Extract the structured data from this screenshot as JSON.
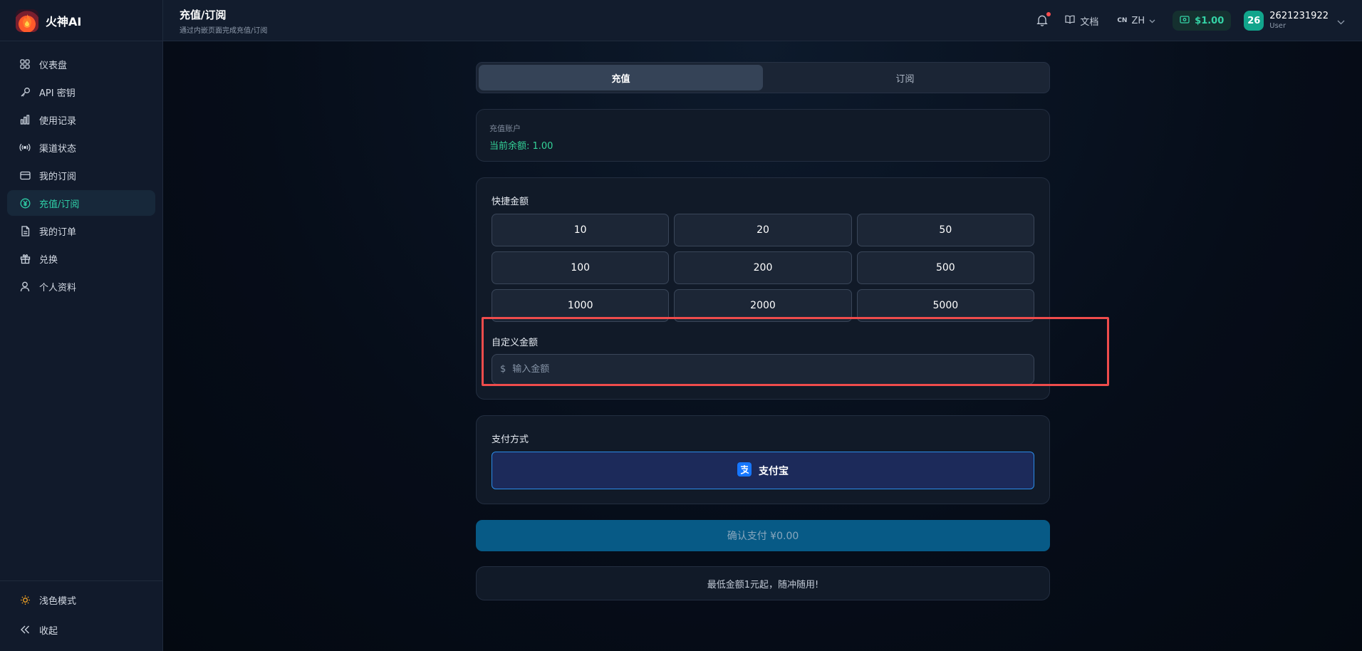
{
  "brand": {
    "name": "火神AI"
  },
  "sidebar": {
    "items": [
      {
        "label": "仪表盘",
        "icon": "grid-icon"
      },
      {
        "label": "API 密钥",
        "icon": "key-icon"
      },
      {
        "label": "使用记录",
        "icon": "bar-chart-icon"
      },
      {
        "label": "渠道状态",
        "icon": "broadcast-icon"
      },
      {
        "label": "我的订阅",
        "icon": "credit-card-icon"
      },
      {
        "label": "充值/订阅",
        "icon": "yuan-circle-icon",
        "active": true
      },
      {
        "label": "我的订单",
        "icon": "document-icon"
      },
      {
        "label": "兑换",
        "icon": "gift-icon"
      },
      {
        "label": "个人资料",
        "icon": "user-icon"
      }
    ],
    "bottom": [
      {
        "label": "浅色模式",
        "icon": "sun-icon"
      },
      {
        "label": "收起",
        "icon": "collapse-icon"
      }
    ]
  },
  "header": {
    "title": "充值/订阅",
    "subtitle": "通过内嵌页面完成充值/订阅",
    "docs_label": "文档",
    "lang_flag": "CN",
    "lang_label": "ZH",
    "balance": "$1.00",
    "avatar_text": "26",
    "user_name": "2621231922",
    "user_role": "User"
  },
  "tabs": [
    {
      "label": "充值",
      "active": true
    },
    {
      "label": "订阅",
      "active": false
    }
  ],
  "account": {
    "label": "充值账户",
    "balance_text": "当前余额: 1.00"
  },
  "quick_amounts": {
    "label": "快捷金额",
    "values": [
      "10",
      "20",
      "50",
      "100",
      "200",
      "500",
      "1000",
      "2000",
      "5000"
    ]
  },
  "custom_amount": {
    "label": "自定义金额",
    "currency": "$",
    "placeholder": "输入金额",
    "value": ""
  },
  "payment": {
    "label": "支付方式",
    "method": "支付宝"
  },
  "confirm_label": "确认支付 ¥0.00",
  "note": "最低金额1元起，随冲随用!",
  "colors": {
    "accent": "#2fd0a8",
    "balance_green": "#34d399",
    "highlight_red": "#ef4c4c",
    "confirm_blue": "#075a86",
    "alipay_blue": "#1677ff"
  }
}
